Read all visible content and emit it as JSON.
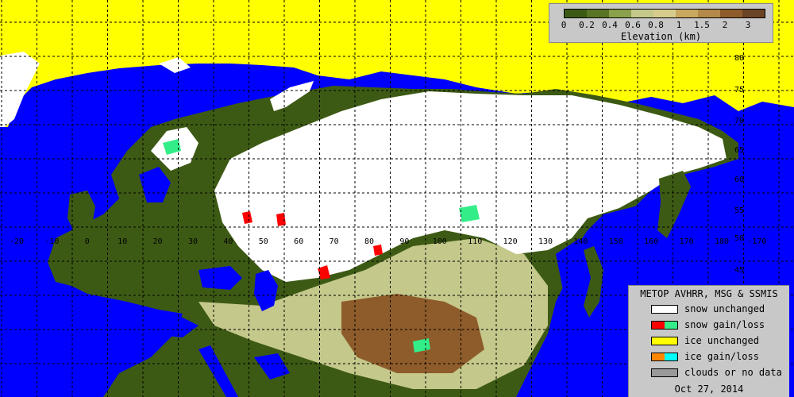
{
  "colors": {
    "ocean": "#0000ff",
    "snow": "#ffffff",
    "ice": "#ffff00",
    "lowland": "#3d5a14",
    "snow_gain": "#ff0000",
    "snow_loss": "#33ee88",
    "ice_gain": "#ff8800",
    "ice_loss": "#00ffff",
    "clouds": "#999999"
  },
  "elevation_scale": {
    "title": "Elevation (km)",
    "ticks": [
      "0",
      "0.2",
      "0.4",
      "0.6",
      "0.8",
      "1",
      "1.5",
      "2",
      "3"
    ],
    "colors": [
      "#3d5a14",
      "#5a7426",
      "#8aa04a",
      "#c4c88a",
      "#d8cc8c",
      "#c9a860",
      "#b48a4a",
      "#8e5c2a",
      "#6a4426"
    ]
  },
  "grid": {
    "lon_labels": [
      "-20",
      "-10",
      "0",
      "10",
      "20",
      "30",
      "40",
      "50",
      "60",
      "70",
      "80",
      "90",
      "100",
      "110",
      "120",
      "130",
      "140",
      "150",
      "160",
      "170",
      "180",
      "-170"
    ],
    "lat_labels": [
      "80",
      "75",
      "70",
      "65",
      "60",
      "55",
      "50",
      "45"
    ]
  },
  "legend": {
    "title": "METOP AVHRR, MSG & SSMIS",
    "items": [
      {
        "label": "snow unchanged",
        "colors": [
          "#ffffff"
        ]
      },
      {
        "label": "snow gain/loss",
        "colors": [
          "#ff0000",
          "#33ee88"
        ]
      },
      {
        "label": "ice unchanged",
        "colors": [
          "#ffff00"
        ]
      },
      {
        "label": "ice gain/loss",
        "colors": [
          "#ff8800",
          "#00ffff"
        ]
      },
      {
        "label": "clouds or no data",
        "colors": [
          "#999999"
        ]
      }
    ],
    "date": "Oct 27, 2014"
  }
}
